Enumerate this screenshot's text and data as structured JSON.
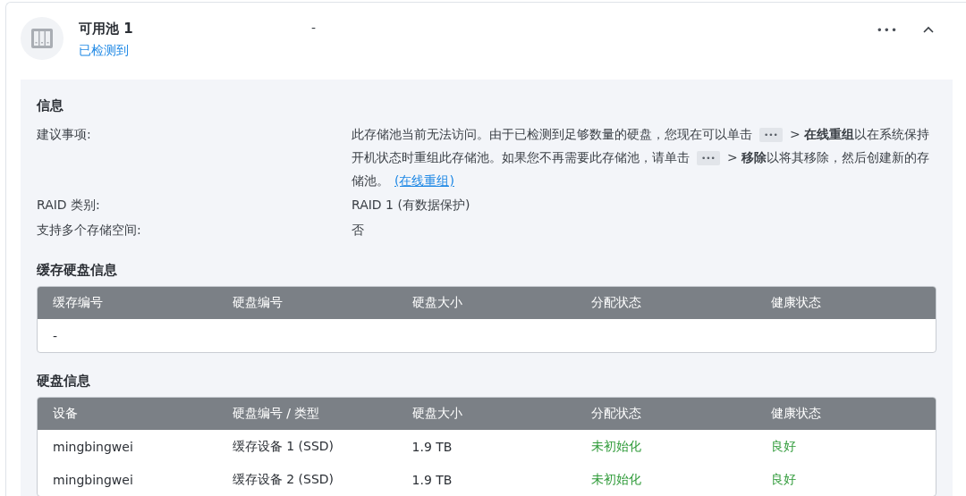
{
  "pool": {
    "title": "可用池 1",
    "status": "已检测到",
    "middle": "-",
    "more": "•••"
  },
  "info": {
    "heading": "信息",
    "rows": [
      {
        "label": "建议事项:",
        "kind": "rich",
        "parts": [
          {
            "kind": "text",
            "text": "此存储池当前无法访问。由于已检测到足够数量的硬盘，您现在可以单击"
          },
          {
            "kind": "chip",
            "text": "•••"
          },
          {
            "kind": "text",
            "text": "> **在线重组**以在系统保持开机状态时重组此存储池。如果您不再需要此存储池，请单击"
          },
          {
            "kind": "chip",
            "text": "•••"
          },
          {
            "kind": "text",
            "text": "> **移除**以将其移除，然后创建新的存储池。"
          },
          {
            "kind": "link",
            "text": "(在线重组)"
          }
        ]
      },
      {
        "label": "RAID 类别:",
        "kind": "plain",
        "value": "RAID 1 (有数据保护)"
      },
      {
        "label": "支持多个存储空间:",
        "kind": "plain",
        "value": "否"
      }
    ]
  },
  "cache": {
    "heading": "缓存硬盘信息",
    "columns": [
      {
        "label": "缓存编号"
      },
      {
        "label": "硬盘编号"
      },
      {
        "label": "硬盘大小"
      },
      {
        "label": "分配状态"
      },
      {
        "label": "健康状态"
      }
    ],
    "rows": [
      [
        "-"
      ]
    ]
  },
  "disks": {
    "heading": "硬盘信息",
    "columns": [
      {
        "label": "设备",
        "kind": "text"
      },
      {
        "label": "硬盘编号 / 类型",
        "kind": "text"
      },
      {
        "label": "硬盘大小",
        "kind": "text"
      },
      {
        "label": "分配状态",
        "kind": "status"
      },
      {
        "label": "健康状态",
        "kind": "status"
      }
    ],
    "rows": [
      [
        "mingbingwei",
        "缓存设备 1 (SSD)",
        "1.9 TB",
        "未初始化",
        "良好"
      ],
      [
        "mingbingwei",
        "缓存设备 2 (SSD)",
        "1.9 TB",
        "未初始化",
        "良好"
      ]
    ]
  }
}
